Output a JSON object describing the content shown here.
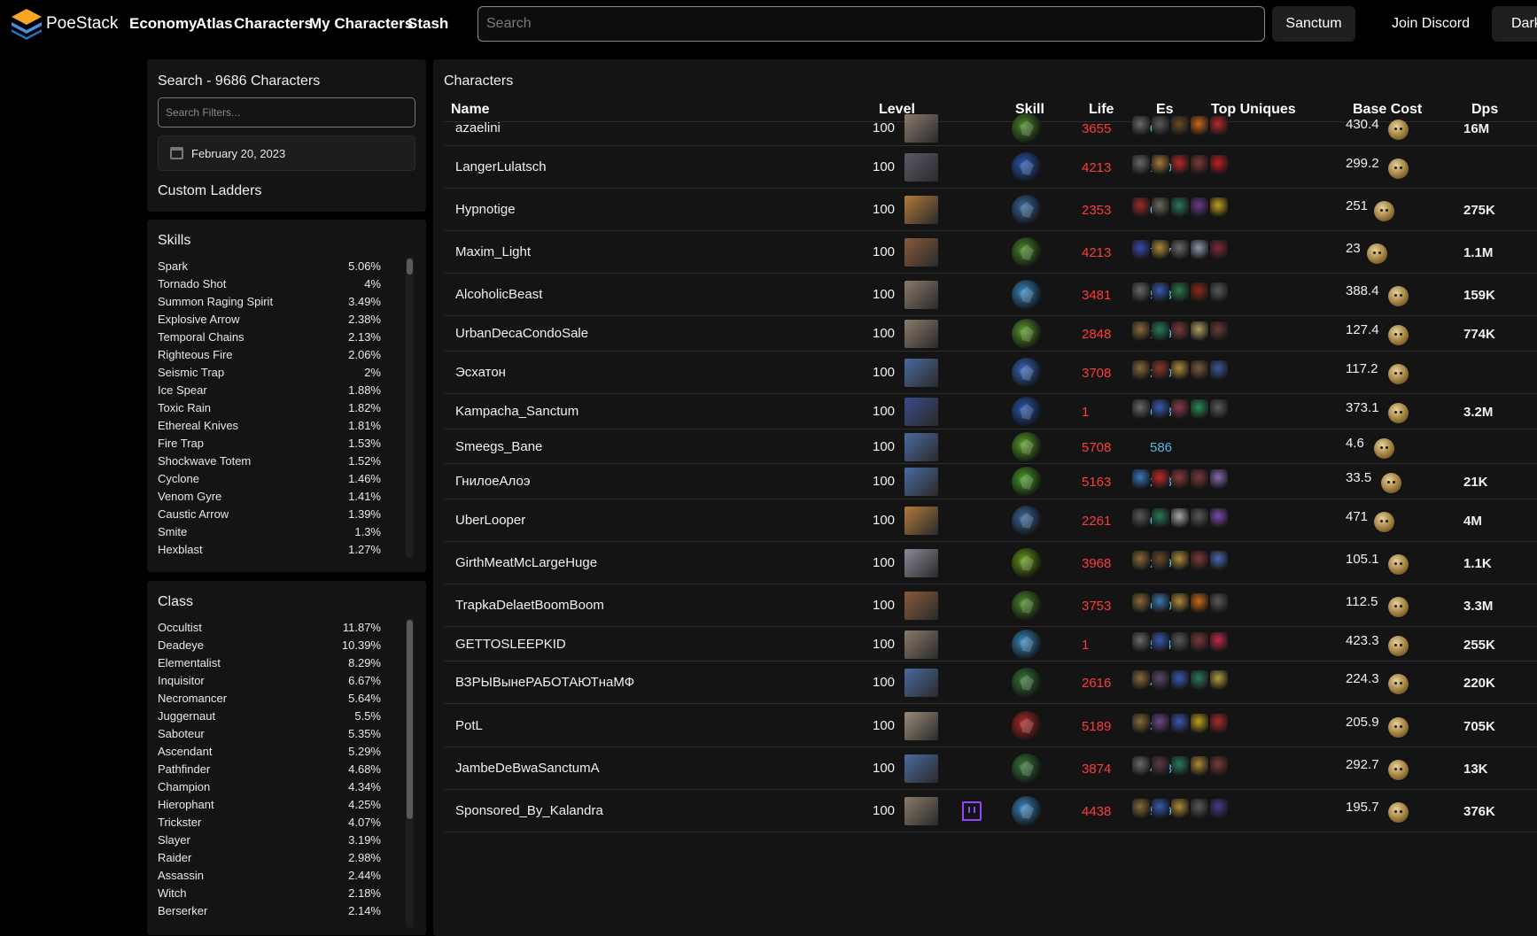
{
  "brand": {
    "name": "PoeStack"
  },
  "nav": [
    "Economy",
    "Atlas",
    "Characters",
    "My Characters",
    "Stash"
  ],
  "search": {
    "placeholder": "Search"
  },
  "buttons": {
    "sanctum": "Sanctum",
    "discord": "Join Discord",
    "dark": "Dark"
  },
  "search_panel": {
    "title": "Search - 9686 Characters",
    "filter_placeholder": "Search Filters...",
    "date": "February 20, 2023",
    "custom_ladders": "Custom Ladders"
  },
  "skills": {
    "title": "Skills",
    "items": [
      {
        "label": "Spark",
        "pct": "5.06%"
      },
      {
        "label": "Tornado Shot",
        "pct": "4%"
      },
      {
        "label": "Summon Raging Spirit",
        "pct": "3.49%"
      },
      {
        "label": "Explosive Arrow",
        "pct": "2.38%"
      },
      {
        "label": "Temporal Chains",
        "pct": "2.13%"
      },
      {
        "label": "Righteous Fire",
        "pct": "2.06%"
      },
      {
        "label": "Seismic Trap",
        "pct": "2%"
      },
      {
        "label": "Ice Spear",
        "pct": "1.88%"
      },
      {
        "label": "Toxic Rain",
        "pct": "1.82%"
      },
      {
        "label": "Ethereal Knives",
        "pct": "1.81%"
      },
      {
        "label": "Fire Trap",
        "pct": "1.53%"
      },
      {
        "label": "Shockwave Totem",
        "pct": "1.52%"
      },
      {
        "label": "Cyclone",
        "pct": "1.46%"
      },
      {
        "label": "Venom Gyre",
        "pct": "1.41%"
      },
      {
        "label": "Caustic Arrow",
        "pct": "1.39%"
      },
      {
        "label": "Smite",
        "pct": "1.3%"
      },
      {
        "label": "Hexblast",
        "pct": "1.27%"
      }
    ]
  },
  "classes": {
    "title": "Class",
    "items": [
      {
        "label": "Occultist",
        "pct": "11.87%"
      },
      {
        "label": "Deadeye",
        "pct": "10.39%"
      },
      {
        "label": "Elementalist",
        "pct": "8.29%"
      },
      {
        "label": "Inquisitor",
        "pct": "6.67%"
      },
      {
        "label": "Necromancer",
        "pct": "5.64%"
      },
      {
        "label": "Juggernaut",
        "pct": "5.5%"
      },
      {
        "label": "Saboteur",
        "pct": "5.35%"
      },
      {
        "label": "Ascendant",
        "pct": "5.29%"
      },
      {
        "label": "Pathfinder",
        "pct": "4.68%"
      },
      {
        "label": "Champion",
        "pct": "4.34%"
      },
      {
        "label": "Hierophant",
        "pct": "4.25%"
      },
      {
        "label": "Trickster",
        "pct": "4.07%"
      },
      {
        "label": "Slayer",
        "pct": "3.19%"
      },
      {
        "label": "Raider",
        "pct": "2.98%"
      },
      {
        "label": "Assassin",
        "pct": "2.44%"
      },
      {
        "label": "Witch",
        "pct": "2.18%"
      },
      {
        "label": "Berserker",
        "pct": "2.14%"
      }
    ]
  },
  "characters": {
    "title": "Characters",
    "columns": [
      "Name",
      "Level",
      "Skill",
      "Life",
      "Es",
      "Top Uniques",
      "Base Cost",
      "Dps"
    ],
    "rows": [
      {
        "name": "azaelini",
        "level": "100",
        "life": "3655",
        "es": "0",
        "cost": "430.4",
        "dps": "16M",
        "avatar": "#8a7a6a",
        "gem": "#4c8a2a",
        "uniques": [
          "#6a6a6a",
          "#5a5a5a",
          "#6a4a2a",
          "#c86a1a",
          "#b82a2a"
        ]
      },
      {
        "name": "LangerLulatsch",
        "level": "100",
        "life": "4213",
        "es": "1709",
        "cost": "299.2",
        "dps": "",
        "avatar": "#5a5a6a",
        "gem": "#2a5ab0",
        "uniques": [
          "#6a6a6a",
          "#a87a3a",
          "#b82a2a",
          "#7a3a3a",
          "#c02020"
        ]
      },
      {
        "name": "Hypnotige",
        "level": "100",
        "life": "2353",
        "es": "0",
        "cost": "251",
        "dps": "275K",
        "avatar": "#b07a3a",
        "gem": "#3a6aa0",
        "uniques": [
          "#a02a2a",
          "#6a6a5a",
          "#2a7a5a",
          "#6a3a8a",
          "#c0a020"
        ]
      },
      {
        "name": "Maxim_Light",
        "level": "100",
        "life": "4213",
        "es": "717",
        "cost": "23",
        "dps": "1.1M",
        "avatar": "#8a5a3a",
        "gem": "#4c8a2a",
        "uniques": [
          "#3a4ab0",
          "#b08a3a",
          "#6a6a6a",
          "#8a9ab0",
          "#7a2a3a"
        ]
      },
      {
        "name": "AlcoholicBeast",
        "level": "100",
        "life": "3481",
        "es": "523",
        "cost": "388.4",
        "dps": "159K",
        "avatar": "#8a7a6a",
        "gem": "#3a8ac0",
        "uniques": [
          "#6a6a6a",
          "#3a5ab0",
          "#2a7a4a",
          "#8a2a1a",
          "#5a5a5a"
        ]
      },
      {
        "name": "UrbanDecaCondoSale",
        "level": "100",
        "life": "2848",
        "es": "189",
        "cost": "127.4",
        "dps": "774K",
        "avatar": "#8a7a6a",
        "gem": "#5a9a2a",
        "uniques": [
          "#8a6a3a",
          "#2a7a5a",
          "#7a3a3a",
          "#b0a060",
          "#6a3a3a"
        ]
      },
      {
        "name": "Эсхатон",
        "level": "100",
        "life": "3708",
        "es": "2304",
        "cost": "117.2",
        "dps": "",
        "avatar": "#4a6aa0",
        "gem": "#3a6ac0",
        "uniques": [
          "#8a6a3a",
          "#8a3a2a",
          "#b08a3a",
          "#7a5a3a",
          "#3a5a9a"
        ]
      },
      {
        "name": "Kampacha_Sanctum",
        "level": "100",
        "life": "1",
        "es": "6684",
        "cost": "373.1",
        "dps": "3.2M",
        "avatar": "#3a4a8a",
        "gem": "#2a5ab0",
        "uniques": [
          "#6a6a6a",
          "#3a5ab0",
          "#8a3a4a",
          "#2a8a5a",
          "#5a5a5a"
        ]
      },
      {
        "name": "Smeegs_Bane",
        "level": "100",
        "life": "5708",
        "es": "586",
        "cost": "4.6",
        "dps": "",
        "avatar": "#4a6aa0",
        "gem": "#5aa02a",
        "uniques": []
      },
      {
        "name": "ГнилоеАлоэ",
        "level": "100",
        "life": "5163",
        "es": "203",
        "cost": "33.5",
        "dps": "21K",
        "avatar": "#4a6aa0",
        "gem": "#4aa02a",
        "uniques": [
          "#3a7ac0",
          "#c02a2a",
          "#8a3a3a",
          "#7a3a3a",
          "#8a6ab0"
        ]
      },
      {
        "name": "UberLooper",
        "level": "100",
        "life": "2261",
        "es": "0",
        "cost": "471",
        "dps": "4M",
        "avatar": "#b07a3a",
        "gem": "#3a6aa0",
        "uniques": [
          "#5a5a5a",
          "#2a7a5a",
          "#aaaaaa",
          "#5a5a5a",
          "#7a4ab0"
        ]
      },
      {
        "name": "GirthMeatMcLargeHuge",
        "level": "100",
        "life": "3968",
        "es": "209",
        "cost": "105.1",
        "dps": "1.1K",
        "avatar": "#8a8a9a",
        "gem": "#6a9a1a",
        "uniques": [
          "#8a6a3a",
          "#6a4a2a",
          "#b08a3a",
          "#7a3a3a",
          "#4a6ab0"
        ]
      },
      {
        "name": "TrapkaDelaetBoomBoom",
        "level": "100",
        "life": "3753",
        "es": "680",
        "cost": "112.5",
        "dps": "3.3M",
        "avatar": "#8a5a3a",
        "gem": "#4c8a2a",
        "uniques": [
          "#8a6a3a",
          "#3a7ab0",
          "#b08a3a",
          "#c86a1a",
          "#5a5a5a"
        ]
      },
      {
        "name": "GETTOSLEEPKID",
        "level": "100",
        "life": "1",
        "es": "5244",
        "cost": "423.3",
        "dps": "255K",
        "avatar": "#8a7a6a",
        "gem": "#3a8ac0",
        "uniques": [
          "#6a6a6a",
          "#3a5ab0",
          "#5a5a5a",
          "#7a3a3a",
          "#c02a4a"
        ]
      },
      {
        "name": "ВЗРЫВынеРАБОТАЮТнаМФ",
        "level": "100",
        "life": "2616",
        "es": "44",
        "cost": "224.3",
        "dps": "220K",
        "avatar": "#4a6aa0",
        "gem": "#3a7a3a",
        "uniques": [
          "#8a6a3a",
          "#5a4a6a",
          "#3a5ab0",
          "#2a7a5a",
          "#b0a040"
        ]
      },
      {
        "name": "PotL",
        "level": "100",
        "life": "5189",
        "es": "37",
        "cost": "205.9",
        "dps": "705K",
        "avatar": "#9a8a7a",
        "gem": "#b02a2a",
        "uniques": [
          "#8a6a3a",
          "#6a4a8a",
          "#3a5ab0",
          "#c0a020",
          "#b02a2a"
        ]
      },
      {
        "name": "JambeDeBwaSanctumA",
        "level": "100",
        "life": "3874",
        "es": "478",
        "cost": "292.7",
        "dps": "13K",
        "avatar": "#4a6aa0",
        "gem": "#3a7a3a",
        "uniques": [
          "#6a6a6a",
          "#5a3a4a",
          "#2a7a5a",
          "#b08a3a",
          "#7a3a3a"
        ]
      },
      {
        "name": "Sponsored_By_Kalandra",
        "level": "100",
        "life": "4438",
        "es": "559",
        "cost": "195.7",
        "dps": "376K",
        "avatar": "#8a7a6a",
        "gem": "#3a8ac0",
        "uniques": [
          "#8a6a3a",
          "#3a5ab0",
          "#b08a3a",
          "#5a5a5a",
          "#4a3a8a"
        ],
        "twitch": true
      }
    ]
  }
}
